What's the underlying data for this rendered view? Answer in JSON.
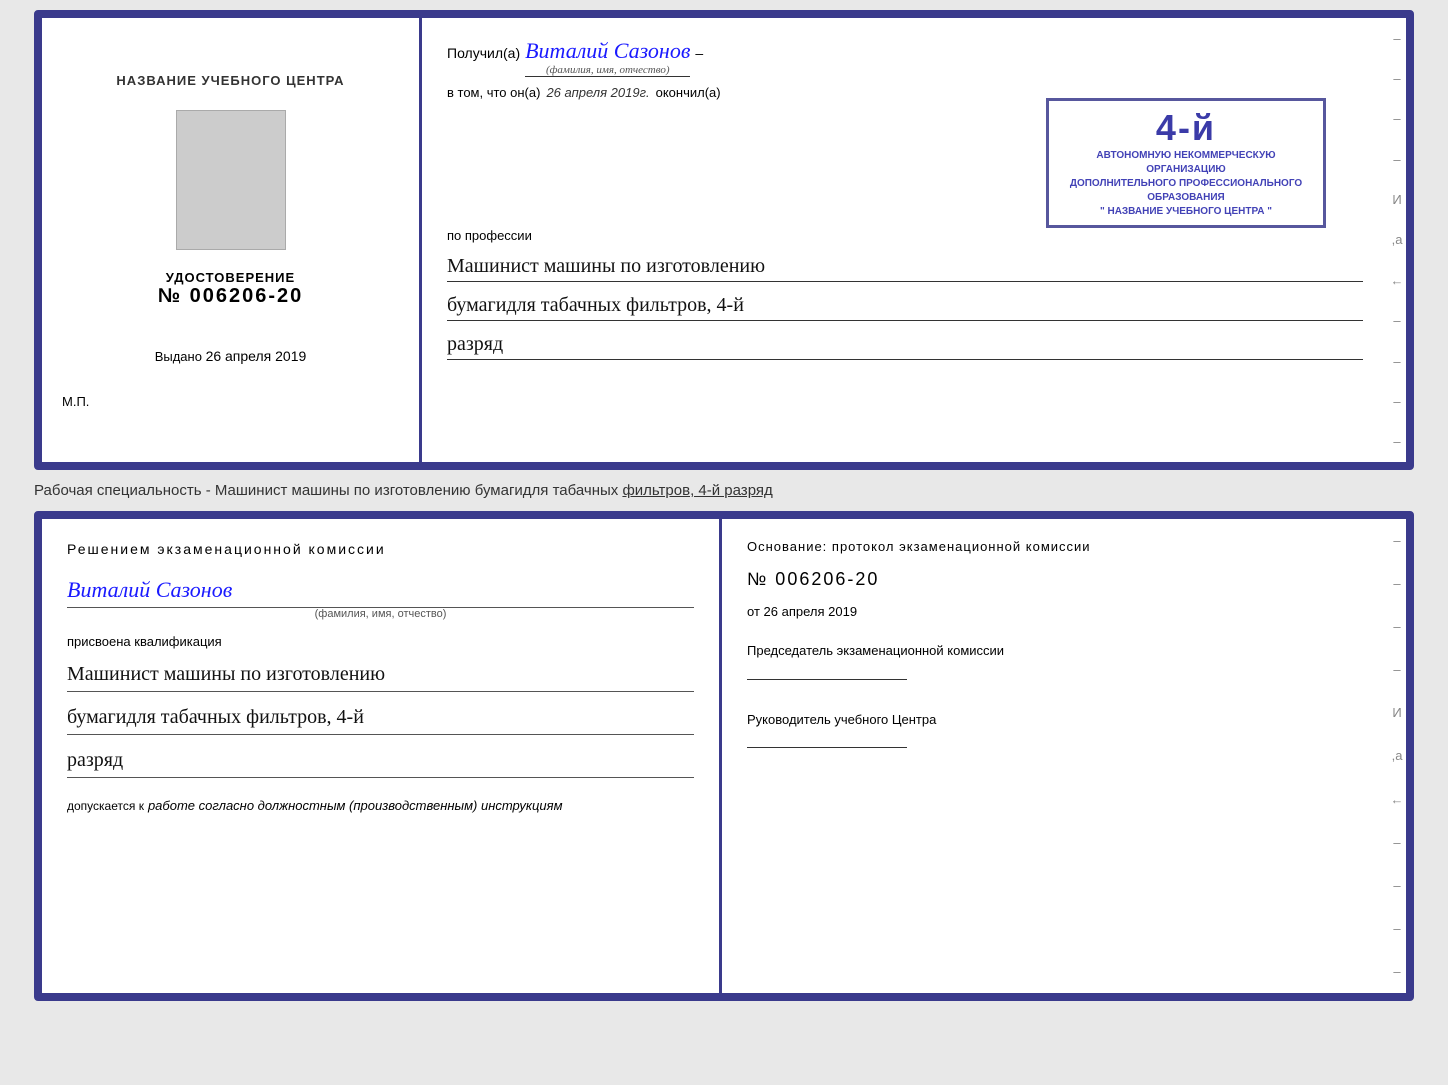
{
  "topCard": {
    "left": {
      "title": "НАЗВАНИЕ УЧЕБНОГО ЦЕНТРА",
      "certLabel": "УДОСТОВЕРЕНИЕ",
      "certNumber": "№ 006206-20",
      "issuedLabel": "Выдано",
      "issuedDate": "26 апреля 2019",
      "mpLabel": "М.П."
    },
    "right": {
      "receivedLabel": "Получил(а)",
      "recipientName": "Виталий Сазонов",
      "recipientCaption": "(фамилия, имя, отчество)",
      "dashAfterName": "–",
      "vtomLabel": "в том, что он(а)",
      "dateHandwritten": "26 апреля 2019г.",
      "completedLabel": "окончил(а)",
      "stampLines": [
        "4-й"
      ],
      "orgLine1": "АВТОНОМНУЮ НЕКОММЕРЧЕСКУЮ ОРГАНИЗАЦИЮ",
      "orgLine2": "ДОПОЛНИТЕЛЬНОГО ПРОФЕССИОНАЛЬНОГО ОБРАЗОВАНИЯ",
      "orgLine3": "\" НАЗВАНИЕ УЧЕБНОГО ЦЕНТРА \"",
      "professionLabel": "по профессии",
      "profession1": "Машинист машины по изготовлению",
      "profession2": "бумагидля табачных фильтров, 4-й",
      "profession3": "разряд"
    }
  },
  "middleStrip": {
    "text": "Рабочая специальность - Машинист машины по изготовлению бумагидля табачных ",
    "underlineText": "фильтров, 4-й разряд"
  },
  "bottomCard": {
    "left": {
      "commissionTitle": "Решением  экзаменационной  комиссии",
      "name": "Виталий Сазонов",
      "nameCaption": "(фамилия, имя, отчество)",
      "assignedLabel": "присвоена квалификация",
      "qual1": "Машинист машины по изготовлению",
      "qual2": "бумагидля табачных фильтров, 4-й",
      "qual3": "разряд",
      "admittedLabel": "допускается к",
      "admittedText": "работе согласно должностным (производственным) инструкциям"
    },
    "right": {
      "basisLabel": "Основание:  протокол  экзаменационной  комиссии",
      "protocolNumber": "№  006206-20",
      "datePrefix": "от",
      "date": "26 апреля 2019",
      "chairmanLabel": "Председатель экзаменационной\nкомиссии",
      "directorLabel": "Руководитель учебного\nЦентра"
    }
  },
  "decorativeDashes": [
    "–",
    "–",
    "–",
    "И",
    ",а",
    "←",
    "–",
    "–",
    "–",
    "–"
  ],
  "bottomRightDashes": [
    "–",
    "–",
    "–",
    "И",
    ",а",
    "←",
    "–",
    "–",
    "–",
    "–"
  ]
}
